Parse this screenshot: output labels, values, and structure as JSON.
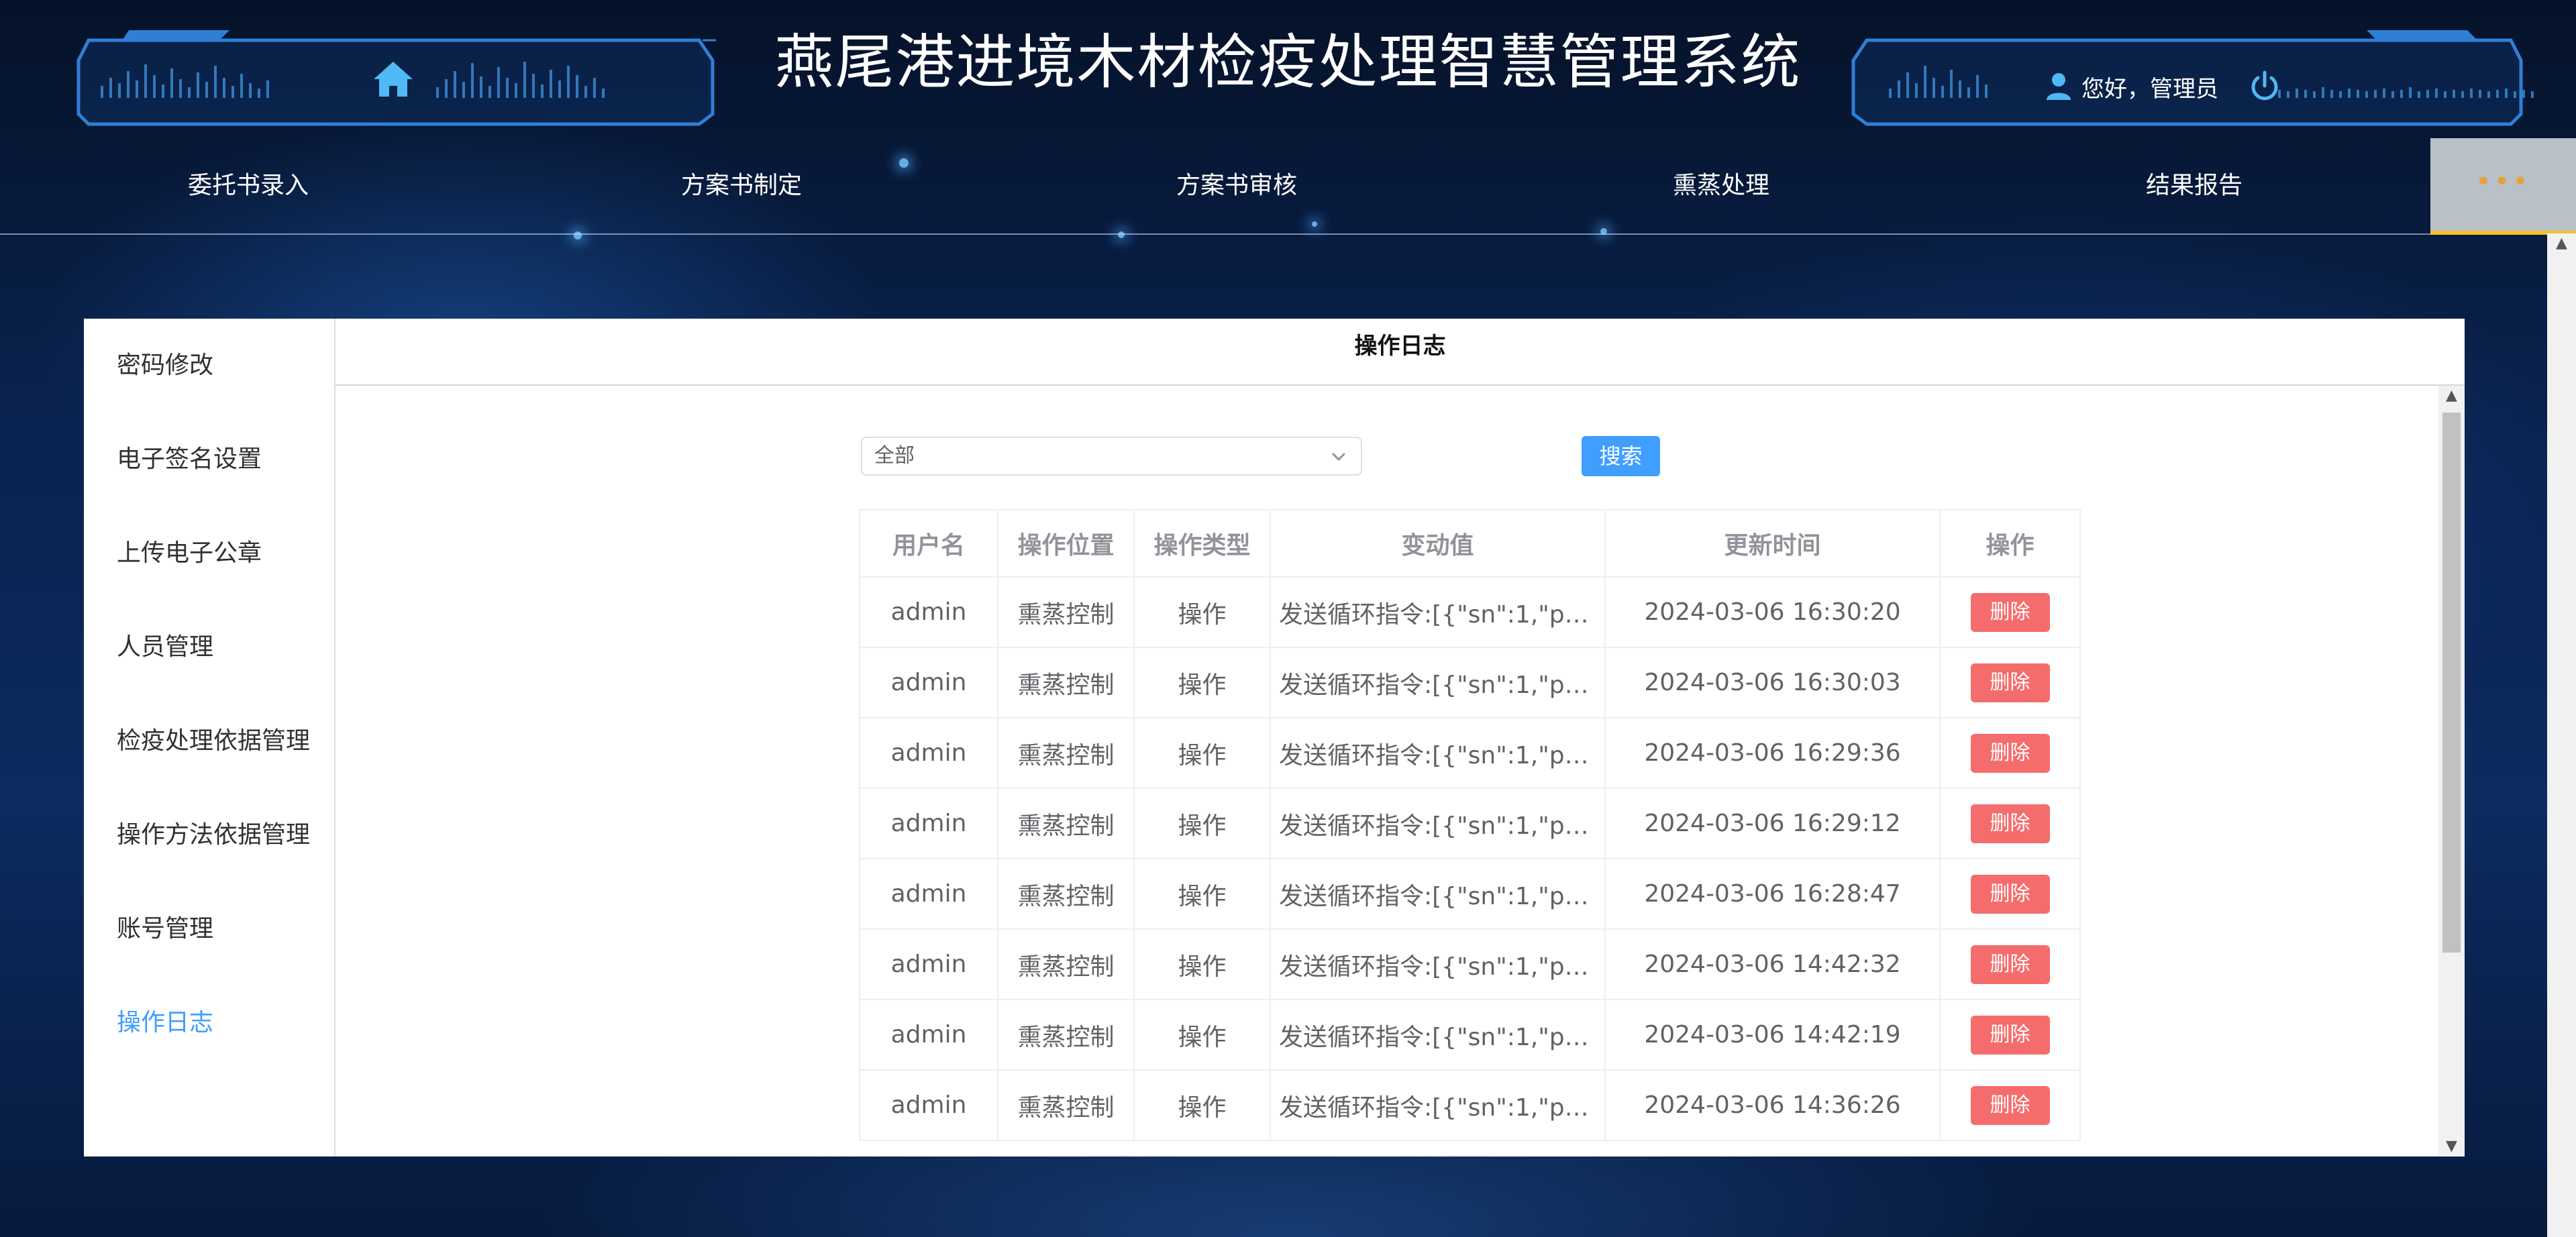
{
  "header": {
    "title": "燕尾港进境木材检疫处理智慧管理系统",
    "greeting": "您好，管理员",
    "home_icon": "home-icon",
    "user_icon": "user-icon",
    "power_icon": "power-icon"
  },
  "nav": {
    "items": [
      "委托书录入",
      "方案书制定",
      "方案书审核",
      "熏蒸处理",
      "结果报告"
    ],
    "more": "•••"
  },
  "sidebar": {
    "items": [
      "密码修改",
      "电子签名设置",
      "上传电子公章",
      "人员管理",
      "检疫处理依据管理",
      "操作方法依据管理",
      "账号管理",
      "操作日志"
    ],
    "active_index": 7
  },
  "content": {
    "title": "操作日志",
    "filter_value": "全部",
    "search_label": "搜索"
  },
  "table": {
    "headers": [
      "用户名",
      "操作位置",
      "操作类型",
      "变动值",
      "更新时间",
      "操作"
    ],
    "rows": [
      [
        "admin",
        "熏蒸控制",
        "操作",
        "发送循环指令:[{\"sn\":1,\"po...",
        "2024-03-06 16:30:20",
        "删除"
      ],
      [
        "admin",
        "熏蒸控制",
        "操作",
        "发送循环指令:[{\"sn\":1,\"po...",
        "2024-03-06 16:30:03",
        "删除"
      ],
      [
        "admin",
        "熏蒸控制",
        "操作",
        "发送循环指令:[{\"sn\":1,\"po...",
        "2024-03-06 16:29:36",
        "删除"
      ],
      [
        "admin",
        "熏蒸控制",
        "操作",
        "发送循环指令:[{\"sn\":1,\"po...",
        "2024-03-06 16:29:12",
        "删除"
      ],
      [
        "admin",
        "熏蒸控制",
        "操作",
        "发送循环指令:[{\"sn\":1,\"po...",
        "2024-03-06 16:28:47",
        "删除"
      ],
      [
        "admin",
        "熏蒸控制",
        "操作",
        "发送循环指令:[{\"sn\":1,\"po...",
        "2024-03-06 14:42:32",
        "删除"
      ],
      [
        "admin",
        "熏蒸控制",
        "操作",
        "发送循环指令:[{\"sn\":1,\"po...",
        "2024-03-06 14:42:19",
        "删除"
      ],
      [
        "admin",
        "熏蒸控制",
        "操作",
        "发送循环指令:[{\"sn\":1,\"po...",
        "2024-03-06 14:36:26",
        "删除"
      ]
    ]
  },
  "colors": {
    "accent": "#409eff",
    "danger": "#f56c6c",
    "nav_more_bg": "#b9c0c7",
    "nav_more_underline": "#f5c12e"
  }
}
